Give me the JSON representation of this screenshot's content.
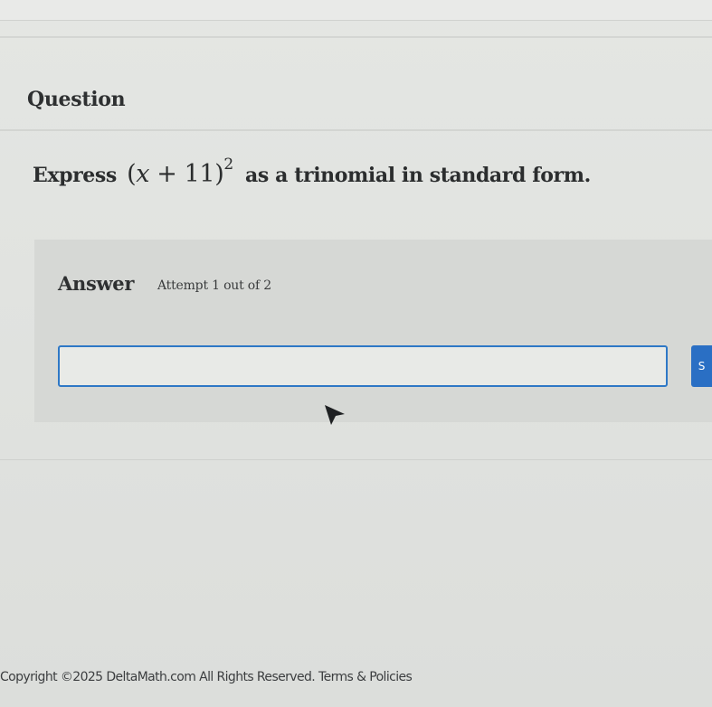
{
  "question": {
    "heading": "Question",
    "prompt_prefix": "Express",
    "expression_open": "(",
    "expression_var": "x",
    "expression_rest": " + 11)",
    "expression_exponent": "2",
    "prompt_suffix": "as a trinomial in standard form."
  },
  "answer": {
    "label": "Answer",
    "attempt_text": "Attempt 1 out of 2",
    "input_value": "",
    "input_placeholder": "",
    "submit_label": "S"
  },
  "footer": {
    "copyright": "Copyright ©2025 DeltaMath.com All Rights Reserved.",
    "terms_link": "Terms & Policies"
  },
  "colors": {
    "accent": "#2e78c6",
    "button": "#2a6fc4",
    "panel": "#d6d8d5"
  },
  "icons": {
    "cursor": "mouse-pointer-icon"
  }
}
